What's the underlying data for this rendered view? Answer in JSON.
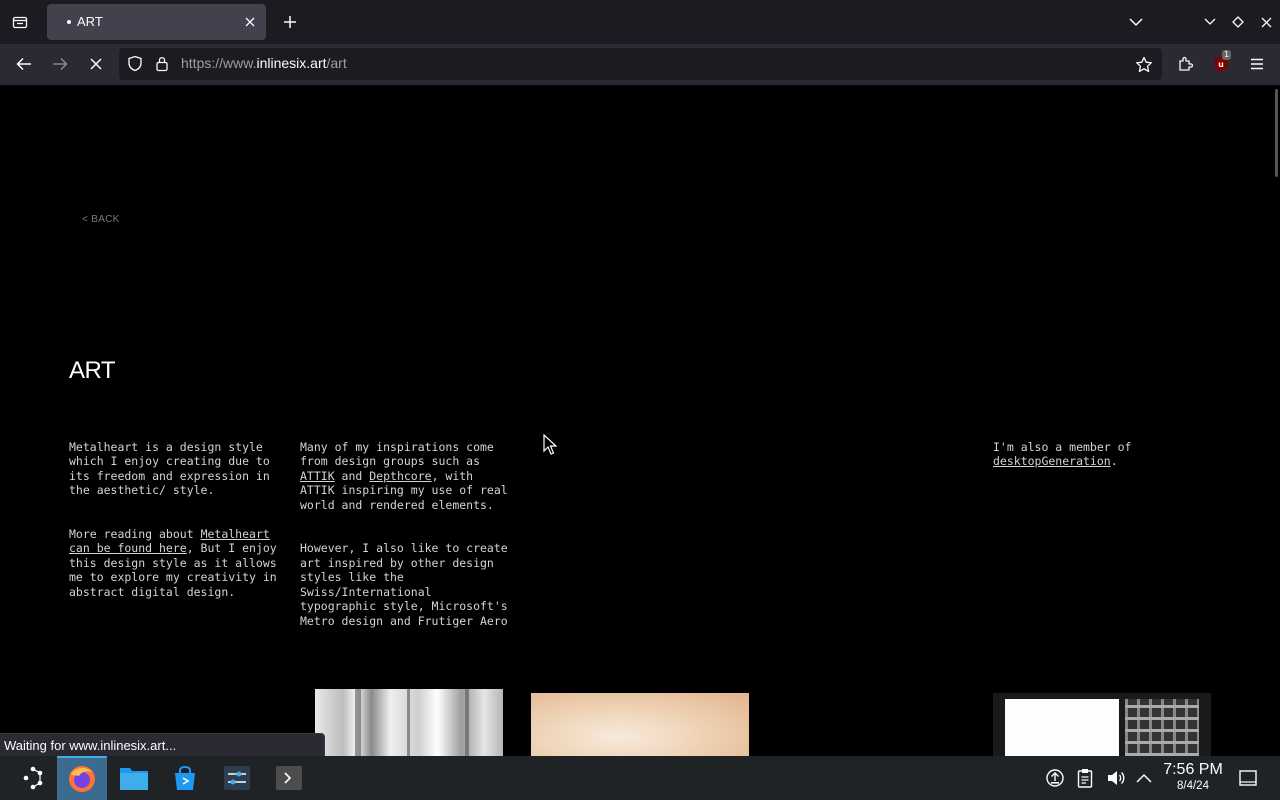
{
  "browser": {
    "tab": {
      "title": "ART"
    },
    "url": {
      "protocol": "https://www.",
      "host": "inlinesix.art",
      "path": "/art"
    },
    "ublock_badge": "1",
    "status_text": "Waiting for www.inlinesix.art..."
  },
  "page": {
    "back_link": "<  BACK",
    "title": "ART",
    "col1": {
      "p1": "Metalheart is a design style which I enjoy creating due to its freedom and expression in the aesthetic/ style.",
      "p2_before": "More reading about ",
      "p2_link": "Metalheart can be found here",
      "p2_after": ", But I enjoy this design style as it allows me to explore my creativity in abstract digital design."
    },
    "col2": {
      "p1_before": "Many of my inspirations come from design groups such as ",
      "p1_link1": "ATTIK",
      "p1_mid": " and ",
      "p1_link2": "Depthcore",
      "p1_after": ", with ATTIK inspiring my use of real world and rendered elements.",
      "p2": "However, I also like to create art inspired by other design styles like the Swiss/International typographic style, Microsoft's Metro design and Frutiger Aero"
    },
    "col3": {
      "before": "I'm also a member of ",
      "link": "desktopGeneration",
      "after": "."
    }
  },
  "taskbar": {
    "clock_time": "7:56 PM",
    "clock_date": "8/4/24"
  },
  "colors": {
    "tabbar_bg": "#1c1b22",
    "navbar_bg": "#2b2a33",
    "page_bg": "#000000",
    "taskbar_bg": "#202326",
    "taskbar_active": "#3daee9",
    "ublock_red": "#800000"
  }
}
